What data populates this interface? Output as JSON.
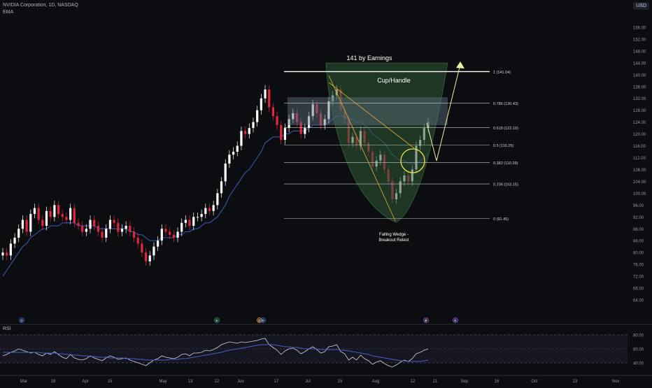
{
  "header": {
    "title": "NVIDIA Corporation, 1D, NASDAQ",
    "indicator": "EMA",
    "currency": "USD"
  },
  "rsi_panel": {
    "label": "RSI"
  },
  "colors": {
    "background": "#0c0d10",
    "up": "#ffffff",
    "down": "#e0283c",
    "ema": "#3a5dc4",
    "rsi": "#d1d4dc",
    "rsi_ma": "#4a5cc7",
    "fib": "#c8c8c8",
    "cup": "#2e5a35",
    "wedge": "#d9a333",
    "circle": "#f0e34a",
    "projection": "#e8f2a0",
    "highlight": "#5a7080"
  },
  "chart_data": [
    {
      "type": "candlestick",
      "title": "NVIDIA Corporation, 1D, NASDAQ",
      "y_axis": {
        "ticks": [
          64.0,
          68.0,
          72.0,
          76.0,
          80.0,
          84.0,
          88.0,
          92.0,
          96.0,
          100.0,
          104.0,
          108.0,
          112.0,
          116.0,
          120.0,
          124.0,
          128.0,
          132.0,
          136.0,
          140.0,
          144.0,
          148.0,
          152.0,
          156.0
        ],
        "range": [
          62,
          158
        ]
      },
      "x_axis": {
        "ticks": [
          "Mar",
          "18",
          "Apr",
          "15",
          "May",
          "13",
          "22",
          "Jun",
          "17",
          "Jul",
          "15",
          "Aug",
          "12",
          "21",
          "Sep",
          "16",
          "Oct",
          "23",
          "Nov"
        ]
      },
      "grid": false,
      "close_series": [
        80,
        79,
        83,
        85,
        88,
        91,
        87,
        93,
        95,
        91,
        89,
        94,
        92,
        96,
        93,
        92,
        91,
        95,
        90,
        89,
        87,
        88,
        91,
        89,
        87,
        85,
        88,
        91,
        90,
        87,
        88,
        89,
        87,
        85,
        83,
        80,
        77,
        79,
        82,
        84,
        88,
        87,
        86,
        85,
        87,
        90,
        91,
        89,
        92,
        92,
        93,
        95,
        94,
        96,
        100,
        104,
        110,
        113,
        114,
        116,
        121,
        120,
        122,
        124,
        128,
        132,
        135,
        129,
        126,
        123,
        118,
        122,
        125,
        127,
        124,
        120,
        122,
        126,
        130,
        127,
        123,
        125,
        131,
        133,
        135,
        128,
        125,
        117,
        119,
        116,
        121,
        117,
        114,
        109,
        111,
        113,
        108,
        104,
        98,
        100,
        104,
        106,
        104,
        108,
        116,
        118,
        122,
        124
      ],
      "ema_series": [
        72,
        74,
        76,
        78,
        80,
        82,
        83,
        85,
        86,
        87,
        88,
        88,
        89,
        89,
        89,
        90,
        90,
        90,
        90,
        89,
        89,
        89,
        89,
        89,
        88,
        88,
        88,
        88,
        88,
        88,
        88,
        88,
        87,
        87,
        86,
        86,
        85,
        84,
        84,
        84,
        85,
        85,
        85,
        85,
        86,
        86,
        87,
        87,
        88,
        88,
        89,
        90,
        90,
        91,
        92,
        94,
        96,
        99,
        101,
        103,
        105,
        107,
        108,
        110,
        112,
        114,
        117,
        118,
        119,
        119,
        119,
        120,
        120,
        121,
        121,
        121,
        121,
        122,
        123,
        123,
        123,
        123,
        124,
        125,
        126,
        126,
        126,
        125,
        125,
        124,
        124,
        123,
        122,
        120,
        119,
        118,
        117,
        115,
        113,
        112,
        111,
        111,
        110,
        110,
        110,
        111,
        112,
        113
      ]
    },
    {
      "type": "line",
      "title": "RSI",
      "y_axis": {
        "ticks": [
          40.0,
          60.0,
          80.0
        ],
        "range": [
          30,
          90
        ]
      },
      "series": [
        {
          "name": "RSI",
          "values": [
            50,
            52,
            55,
            57,
            60,
            58,
            56,
            54,
            55,
            52,
            50,
            54,
            52,
            56,
            52,
            48,
            46,
            52,
            47,
            45,
            44,
            46,
            50,
            47,
            45,
            43,
            47,
            50,
            48,
            45,
            46,
            47,
            44,
            42,
            40,
            38,
            36,
            40,
            44,
            46,
            50,
            48,
            47,
            46,
            48,
            52,
            53,
            50,
            54,
            54,
            55,
            58,
            57,
            59,
            62,
            66,
            68,
            70,
            69,
            68,
            70,
            69,
            70,
            71,
            72,
            74,
            75,
            66,
            62,
            58,
            52,
            57,
            60,
            61,
            58,
            53,
            56,
            60,
            63,
            59,
            54,
            56,
            63,
            64,
            66,
            56,
            53,
            44,
            48,
            44,
            51,
            46,
            43,
            38,
            41,
            43,
            39,
            36,
            34,
            37,
            41,
            44,
            42,
            46,
            53,
            55,
            58,
            60
          ]
        },
        {
          "name": "RSI-based MA",
          "values": [
            55,
            55,
            55,
            55,
            55,
            55,
            55,
            55,
            55,
            55,
            54,
            54,
            54,
            54,
            53,
            53,
            52,
            52,
            51,
            51,
            50,
            50,
            49,
            49,
            48,
            48,
            48,
            47,
            47,
            47,
            47,
            46,
            46,
            46,
            45,
            45,
            44,
            44,
            44,
            44,
            44,
            44,
            45,
            45,
            45,
            46,
            46,
            47,
            48,
            49,
            50,
            51,
            52,
            53,
            54,
            55,
            57,
            58,
            59,
            60,
            61,
            62,
            63,
            64,
            65,
            66,
            66,
            66,
            66,
            65,
            64,
            63,
            63,
            62,
            62,
            61,
            60,
            60,
            60,
            60,
            59,
            59,
            59,
            59,
            59,
            58,
            58,
            57,
            56,
            55,
            54,
            53,
            52,
            50,
            49,
            48,
            47,
            46,
            45,
            44,
            43,
            43,
            42,
            42,
            42,
            42,
            43,
            44
          ]
        }
      ]
    }
  ],
  "fibonacci": {
    "levels": [
      {
        "label": "1 (141.04)",
        "value": 141.04
      },
      {
        "label": "0.786 (130.43)",
        "value": 130.43
      },
      {
        "label": "0.618 (122.10)",
        "value": 122.1
      },
      {
        "label": "0.5 (116.25)",
        "value": 116.25
      },
      {
        "label": "0.382 (110.39)",
        "value": 110.39
      },
      {
        "label": "0.236 (103.15)",
        "value": 103.15
      },
      {
        "label": "0 (91.45)",
        "value": 91.45
      }
    ]
  },
  "annotations": {
    "earnings": "141 by Earnings",
    "pattern": "Cup/Handle",
    "wedge_line1": "Falling Wedge -",
    "wedge_line2": "Breakout Retest"
  },
  "event_markers": [
    "D",
    "E",
    "D",
    "D",
    "⚡",
    "E"
  ]
}
